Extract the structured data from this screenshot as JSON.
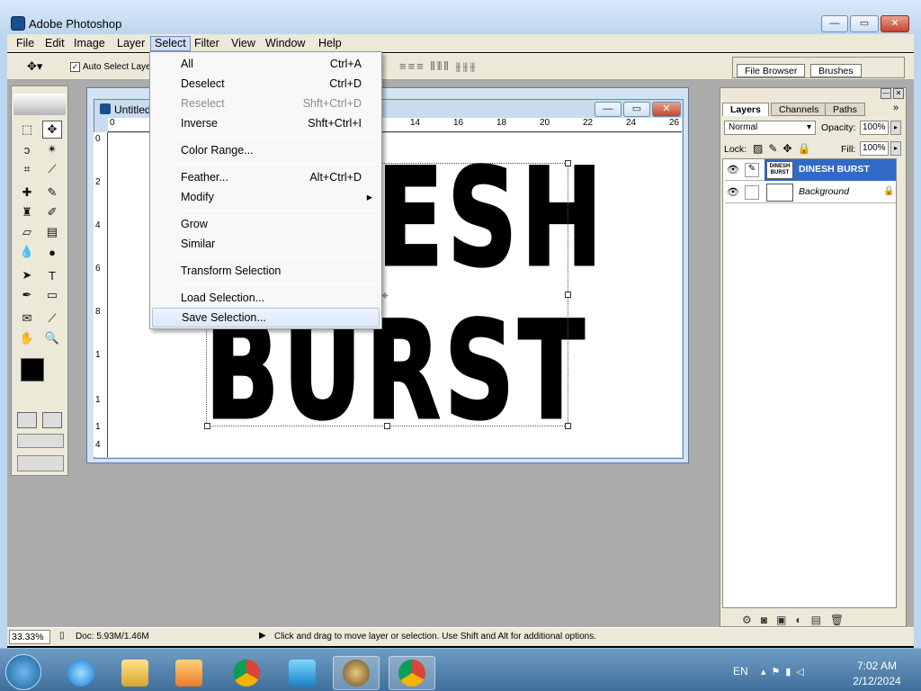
{
  "window": {
    "title": "Adobe Photoshop",
    "min": "—",
    "max": "▭",
    "close": "✕"
  },
  "menubar": [
    "File",
    "Edit",
    "Image",
    "Layer",
    "Select",
    "Filter",
    "View",
    "Window",
    "Help"
  ],
  "options": {
    "auto_select": "Auto Select Laye"
  },
  "palette_well": {
    "tabs": [
      "File Browser",
      "Brushes"
    ]
  },
  "document": {
    "title": "Untitled",
    "ruler_top": [
      "0",
      "14",
      "16",
      "18",
      "20",
      "22",
      "24",
      "26"
    ],
    "ruler_left": [
      "0",
      "2",
      "4",
      "6",
      "8",
      "1",
      "1",
      "1",
      "4"
    ],
    "text_line1": "DINESH",
    "text_line2": "BURST"
  },
  "select_menu": {
    "items": [
      {
        "label": "All",
        "shortcut": "Ctrl+A",
        "disabled": false
      },
      {
        "label": "Deselect",
        "shortcut": "Ctrl+D",
        "disabled": false
      },
      {
        "label": "Reselect",
        "shortcut": "Shft+Ctrl+D",
        "disabled": true
      },
      {
        "label": "Inverse",
        "shortcut": "Shft+Ctrl+I",
        "disabled": false
      },
      {
        "label": "Color Range...",
        "shortcut": "",
        "disabled": false
      },
      {
        "label": "Feather...",
        "shortcut": "Alt+Ctrl+D",
        "disabled": false
      },
      {
        "label": "Modify",
        "shortcut": "▸",
        "disabled": false
      },
      {
        "label": "Grow",
        "shortcut": "",
        "disabled": false
      },
      {
        "label": "Similar",
        "shortcut": "",
        "disabled": false
      },
      {
        "label": "Transform Selection",
        "shortcut": "",
        "disabled": false
      },
      {
        "label": "Load Selection...",
        "shortcut": "",
        "disabled": false
      },
      {
        "label": "Save Selection...",
        "shortcut": "",
        "disabled": false
      }
    ]
  },
  "layers_panel": {
    "tabs": [
      "Layers",
      "Channels",
      "Paths"
    ],
    "blend_mode": "Normal",
    "opacity_label": "Opacity:",
    "opacity": "100%",
    "lock_label": "Lock:",
    "fill_label": "Fill:",
    "fill": "100%",
    "layers": [
      {
        "name": "DINESH BURST",
        "thumb": "DINESH BURST",
        "selected": true
      },
      {
        "name": "Background",
        "thumb": "",
        "selected": false
      }
    ]
  },
  "status": {
    "zoom": "33.33%",
    "doc": "Doc: 5.93M/1.46M",
    "hint": "Click and drag to move layer or selection. Use Shift and Alt for additional options."
  },
  "taskbar": {
    "lang": "EN",
    "time": "7:02 AM",
    "date": "2/12/2024"
  },
  "colors": {
    "accent": "#316ac5",
    "menu_bg": "#ece9d8",
    "workspace": "#ababab"
  }
}
